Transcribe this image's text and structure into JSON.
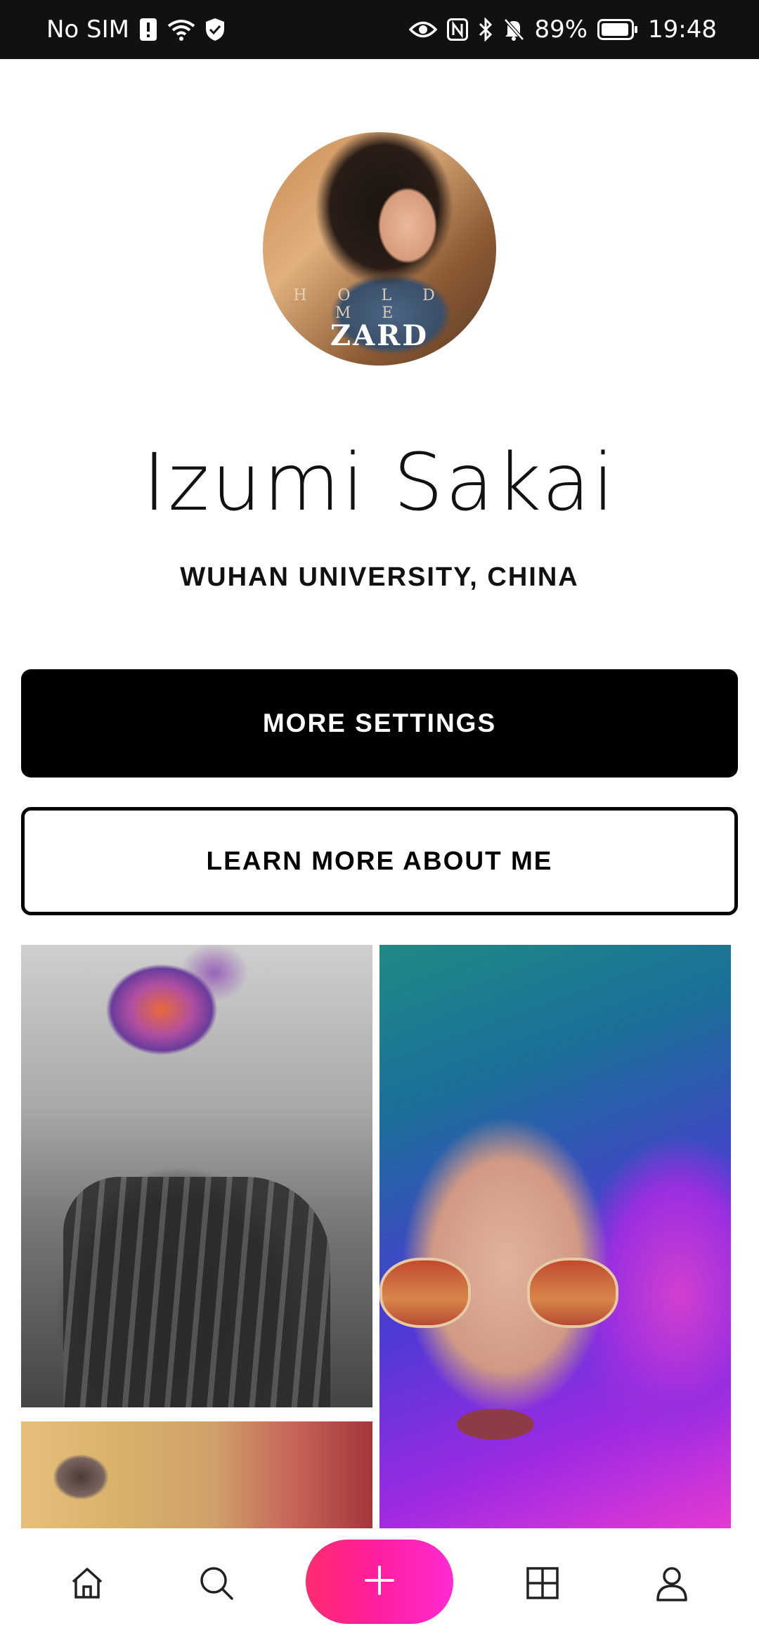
{
  "status_bar": {
    "carrier": "No SIM",
    "battery": "89%",
    "time": "19:48",
    "icons": [
      "sim-alert-icon",
      "wifi-icon",
      "shield-check-icon",
      "eye-icon",
      "nfc-icon",
      "bluetooth-icon",
      "bell-muted-icon",
      "battery-icon"
    ]
  },
  "profile": {
    "avatar_text_top": "HOLD ME",
    "avatar_brand": "ZARD",
    "name": "Izumi Sakai",
    "subtitle": "WUHAN UNIVERSITY, CHINA"
  },
  "buttons": {
    "more_settings": "MORE SETTINGS",
    "learn_more": "LEARN MORE ABOUT ME"
  },
  "gallery": {
    "photos": [
      "rainbow-hair-back",
      "teal-purple-hair-glasses",
      "warm-interior"
    ]
  },
  "bottom_nav": {
    "items": [
      "home-icon",
      "search-icon",
      "plus-icon",
      "grid-icon",
      "user-icon"
    ],
    "accent_gradient": [
      "#ff2b6f",
      "#ff2ad2"
    ]
  }
}
